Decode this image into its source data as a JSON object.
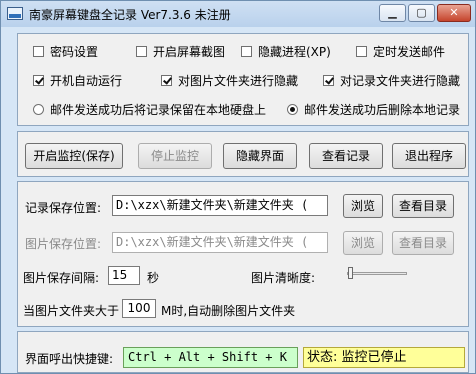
{
  "window": {
    "title": "南豪屏幕键盘全记录  Ver7.3.6  未注册",
    "min_label": "▁",
    "max_label": "▢",
    "close_label": "✕"
  },
  "options": {
    "password_setting": {
      "label": "密码设置",
      "checked": false
    },
    "screen_capture": {
      "label": "开启屏幕截图",
      "checked": false
    },
    "hide_process": {
      "label": "隐藏进程(XP)",
      "checked": false
    },
    "timed_email": {
      "label": "定时发送邮件",
      "checked": false
    },
    "autostart": {
      "label": "开机自动运行",
      "checked": true
    },
    "hide_image_folder": {
      "label": "对图片文件夹进行隐藏",
      "checked": true
    },
    "hide_record_folder": {
      "label": "对记录文件夹进行隐藏",
      "checked": true
    },
    "keep_local_after_mail": {
      "label": "邮件发送成功后将记录保留在本地硬盘上",
      "selected": false
    },
    "delete_local_after_mail": {
      "label": "邮件发送成功后删除本地记录",
      "selected": true
    }
  },
  "actions": {
    "start": "开启监控(保存)",
    "stop": "停止监控",
    "hide_ui": "隐藏界面",
    "view_records": "查看记录",
    "exit": "退出程序"
  },
  "paths": {
    "record_label": "记录保存位置:",
    "record_value": "D:\\xzx\\新建文件夹\\新建文件夹 (",
    "image_label": "图片保存位置:",
    "image_value": "D:\\xzx\\新建文件夹\\新建文件夹 (",
    "browse": "浏览",
    "view_dir": "查看目录"
  },
  "capture": {
    "interval_label": "图片保存间隔:",
    "interval_value": "15",
    "interval_unit": "秒",
    "clarity_label": "图片清晰度:",
    "clarity_level": 0.05,
    "folder_limit_prefix": "当图片文件夹大于",
    "folder_limit_value": "100",
    "folder_limit_suffix": "M时,自动删除图片文件夹"
  },
  "footer": {
    "hotkey_label": "界面呼出快捷键:",
    "hotkey_value": "Ctrl + Alt + Shift + K",
    "status_text": "状态: 监控已停止"
  }
}
